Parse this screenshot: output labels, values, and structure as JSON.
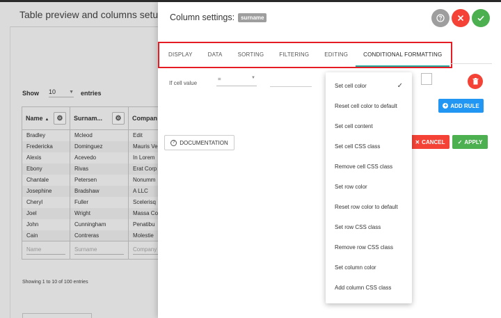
{
  "background": {
    "title": "Table preview and columns setup",
    "show": {
      "prefix": "Show",
      "value": "10",
      "suffix": "entries"
    },
    "columns": [
      "Name",
      "Surnam...",
      "Compan"
    ],
    "rows": [
      [
        "Bradley",
        "Mcleod",
        "Edit"
      ],
      [
        "Fredericka",
        "Dominguez",
        "Mauris Ve"
      ],
      [
        "Alexis",
        "Acevedo",
        "In Lorem"
      ],
      [
        "Ebony",
        "Rivas",
        "Erat Corp"
      ],
      [
        "Chantale",
        "Petersen",
        "Nonumm"
      ],
      [
        "Josephine",
        "Bradshaw",
        "A LLC"
      ],
      [
        "Cheryl",
        "Fuller",
        "Scelerisq"
      ],
      [
        "Joel",
        "Wright",
        "Massa Co"
      ],
      [
        "John",
        "Cunningham",
        "Penatibu"
      ],
      [
        "Cain",
        "Contreras",
        "Molestie"
      ]
    ],
    "filters": [
      "Name",
      "Surname",
      "Company"
    ],
    "showing": "Showing 1 to 10 of 100 entries"
  },
  "panel": {
    "title": "Column settings:",
    "column_tag": "surname",
    "tabs": [
      "DISPLAY",
      "DATA",
      "SORTING",
      "FILTERING",
      "EDITING",
      "CONDITIONAL FORMATTING"
    ],
    "active_tab": "CONDITIONAL FORMATTING",
    "rule": {
      "label": "If cell value",
      "operator": "="
    },
    "add_rule": "ADD RULE",
    "documentation": "DOCUMENTATION",
    "cancel": "CANCEL",
    "apply": "APPLY"
  },
  "dropdown": {
    "selected": "Set cell color",
    "items": [
      "Set cell color",
      "Reset cell color to default",
      "Set cell content",
      "Set cell CSS class",
      "Remove cell CSS class",
      "Set row color",
      "Reset row color to default",
      "Set row CSS class",
      "Remove row CSS class",
      "Set column color",
      "Add column CSS class"
    ]
  },
  "colors": {
    "highlight_frame": "#e51c23",
    "active_tab_underline": "#26a69a",
    "help_button": "#9e9e9e",
    "close_button": "#f44336",
    "ok_button": "#4caf50",
    "add_rule_button": "#2196f3"
  }
}
